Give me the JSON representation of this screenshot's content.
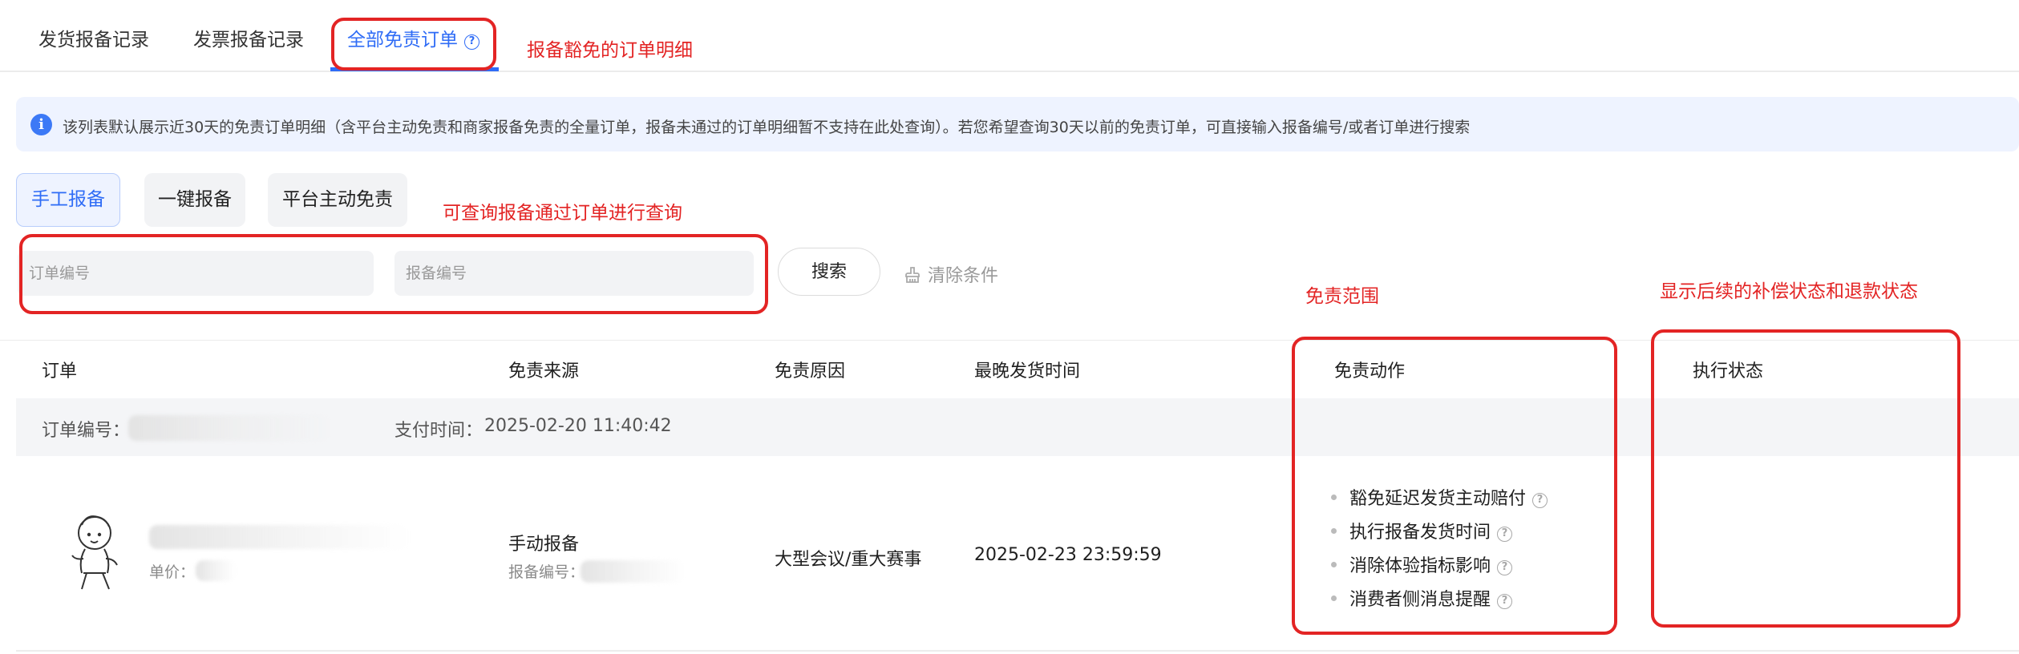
{
  "tabs": {
    "items": [
      "发货报备记录",
      "发票报备记录"
    ],
    "active_label": "全部免责订单"
  },
  "info_banner": {
    "text": "该列表默认展示近30天的免责订单明细（含平台主动免责和商家报备免责的全量订单，报备未通过的订单明细暂不支持在此处查询）。若您希望查询30天以前的免责订单，可直接输入报备编号/或者订单进行搜索"
  },
  "filters": [
    "手工报备",
    "一键报备",
    "平台主动免责"
  ],
  "search": {
    "order_placeholder": "订单编号",
    "report_placeholder": "报备编号",
    "search_label": "搜索",
    "clear_label": "清除条件"
  },
  "annotations": {
    "tab_note": "报备豁免的订单明细",
    "search_note": "可查询报备通过订单进行查询",
    "scope_note": "免责范围",
    "status_note": "显示后续的补偿状态和退款状态"
  },
  "table": {
    "headers": [
      "订单",
      "免责来源",
      "免责原因",
      "最晚发货时间",
      "免责动作",
      "执行状态"
    ],
    "order_no_label": "订单编号：",
    "pay_time_label": "支付时间：",
    "pay_time": "2025-02-20 11:40:42",
    "row": {
      "price_label": "单价：",
      "source": "手动报备",
      "report_no_label": "报备编号：",
      "reason": "大型会议/重大赛事",
      "deadline": "2025-02-23 23:59:59",
      "actions": [
        "豁免延迟发货主动赔付",
        "执行报备发货时间",
        "消除体验指标影响",
        "消费者侧消息提醒"
      ]
    }
  },
  "colors": {
    "accent": "#2f6cf6",
    "annotation_red": "#e32424",
    "banner_bg": "#eef3ff"
  }
}
